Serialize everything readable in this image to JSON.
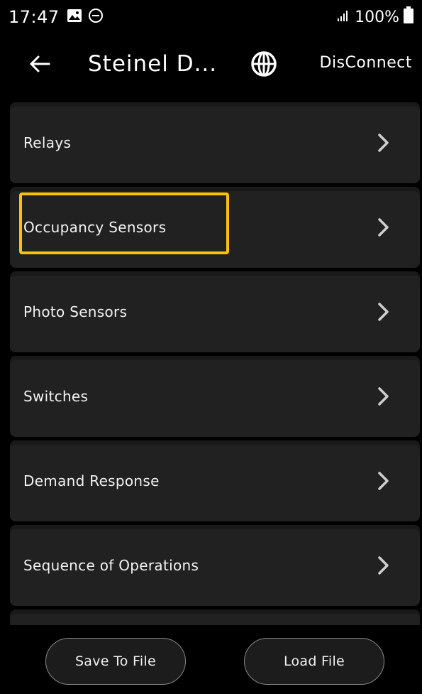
{
  "status_bar": {
    "time": "17:47",
    "battery": "100%",
    "icons": [
      "gallery-icon",
      "dnd-icon",
      "signal-icon",
      "battery-icon"
    ]
  },
  "app_bar": {
    "title": "Steinel D...",
    "disconnect_label": "DisConnect",
    "icons": [
      "back-arrow-icon",
      "globe-icon"
    ]
  },
  "menu": {
    "items": [
      {
        "label": "Relays"
      },
      {
        "label": "Occupancy Sensors"
      },
      {
        "label": "Photo Sensors"
      },
      {
        "label": "Switches"
      },
      {
        "label": "Demand Response"
      },
      {
        "label": "Sequence of Operations"
      }
    ]
  },
  "bottom_bar": {
    "save_label": "Save To File",
    "load_label": "Load File"
  },
  "colors": {
    "background": "#000000",
    "card": "#212121",
    "highlight": "#ffc107",
    "text": "#ffffff"
  }
}
